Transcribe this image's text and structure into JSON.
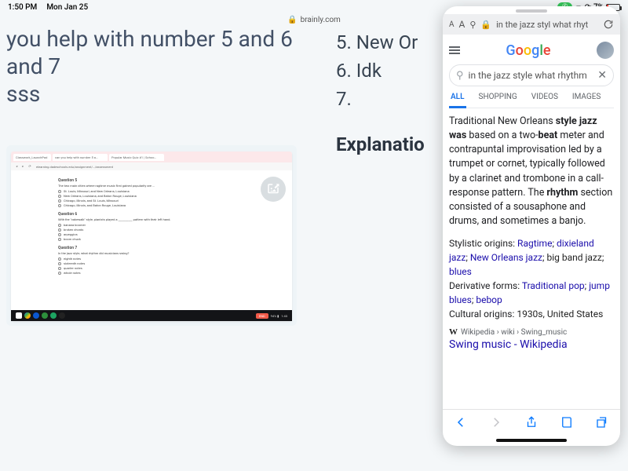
{
  "statusbar": {
    "time": "1:50 PM",
    "date": "Mon Jan 25",
    "battery_pct": "7%",
    "battery_icon": "battery-low-icon"
  },
  "main_url": "brainly.com",
  "question_title_line1": "you help with number 5 and 6 and 7",
  "question_title_line2": "sss",
  "mini": {
    "tab1": "Classwork_LaunchPad",
    "tab2": "can you help with number 5 a…",
    "tab3": "Popular Music Quiz #1 | Schoo…",
    "url": "elearning.dadeschools.edu/assignment/…/assessment",
    "q5": {
      "head": "Question 5",
      "sub": "The two main cities where ragtime music first gained popularity are ...",
      "opts": [
        "St. Louis, Missouri, and New Orleans, Louisiana",
        "New Orleans, Louisiana, and Baton Rouge, Louisiana",
        "Chicago, Illinois, and St. Louis, Missouri",
        "Chicago, Illinois, and Baton Rouge, Louisiana"
      ]
    },
    "q6": {
      "head": "Question 6",
      "sub": "With the \"cakewalk\" style, pianists played a __________ pattern with their left hand.",
      "opts": [
        "banana boomer",
        "broken chords",
        "arpeggios",
        "boom chuck"
      ]
    },
    "q7": {
      "head": "Question 7",
      "sub": "In the jazz style, what rhythm did musicians swing?",
      "opts": [
        "eighth notes",
        "sixteenth notes",
        "quarter notes",
        "whole notes"
      ]
    },
    "time_right": "1:43"
  },
  "answers": {
    "l5": "5. New Or",
    "l6": "6. Idk",
    "l7": "7."
  },
  "explanation_heading": "Explanatio",
  "slideover": {
    "url_text": "in the jazz styl what rhyt",
    "search_query": "in the jazz style what rhythm",
    "tabs": {
      "all": "ALL",
      "shopping": "SHOPPING",
      "videos": "VIDEOS",
      "images": "IMAGES"
    },
    "snippet_parts": {
      "p1": "Traditional New Orleans ",
      "b1": "style jazz was",
      "p2": " based on a two-",
      "b2": "beat",
      "p3": " meter and contrapuntal improvisation led by a trumpet or cornet, typically followed by a clarinet and trombone in a call-response pattern. The ",
      "b3": "rhythm",
      "p4": " section consisted of a sousaphone and drums, and sometimes a banjo."
    },
    "meta": {
      "stylistic_label": "Stylistic origins: ",
      "stylistic_links": [
        "Ragtime",
        "dixieland jazz",
        "New Orleans jazz"
      ],
      "stylistic_tail": "big band jazz",
      "stylistic_last": "blues",
      "deriv_label": "Derivative forms: ",
      "deriv_links": [
        "Traditional pop",
        "jump blues",
        "bebop"
      ],
      "cultural_label": "Cultural origins: ",
      "cultural_value": "1930s, United States"
    },
    "wiki_breadcrumb": "Wikipedia › wiki › Swing_music",
    "result_title": "Swing music - Wikipedia"
  }
}
